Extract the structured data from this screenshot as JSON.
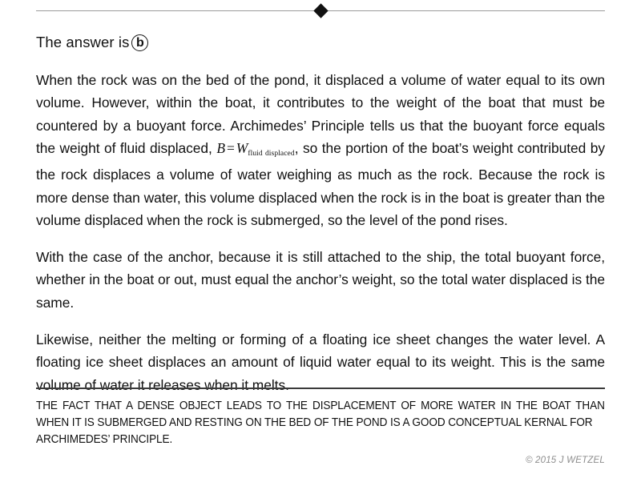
{
  "header": {
    "answer_prefix": "The answer is",
    "answer_choice": "b"
  },
  "body": {
    "paragraphs": [
      {
        "segments": [
          {
            "type": "text",
            "value": "When the rock was on the bed of the pond, it displaced a volume of water equal to its own volume.  However, within the boat, it contributes to the weight of the boat that must be countered by a buoyant force.  Archimedes’ Principle tells us that the buoyant force equals the weight of fluid displaced, "
          },
          {
            "type": "math",
            "lhs": "B",
            "operator": "=",
            "rhs": "W",
            "subscript": "fluid displaced"
          },
          {
            "type": "text",
            "value": ", so the portion of the boat’s weight contributed by the rock displaces a volume of water weighing as much as the rock.  Because the rock is more dense than water, this volume displaced when the rock is in the boat is greater than the volume displaced when the rock is submerged, so the level of the pond rises."
          }
        ]
      },
      {
        "segments": [
          {
            "type": "text",
            "value": "With the case of the anchor, because it is still attached to the ship, the total buoyant force, whether in the boat or out, must equal the anchor’s weight, so the total water displaced is the same."
          }
        ]
      },
      {
        "segments": [
          {
            "type": "text",
            "value": "Likewise, neither the melting or forming of a floating ice sheet changes the water level.  A floating ice sheet displaces an amount of liquid water equal to its weight.  This is the same volume of water it releases when it melts."
          }
        ]
      }
    ]
  },
  "footer": {
    "note_main": "THE FACT THAT A DENSE OBJECT LEADS TO THE DISPLACEMENT OF MORE WATER IN THE BOAT THAN WHEN IT IS SUBMERGED AND RESTING ON THE BED OF THE POND IS A GOOD CONCEPTUAL KERNAL FOR",
    "note_last_line": "ARCHIMEDES’ PRINCIPLE.",
    "copyright": "© 2015 J WETZEL"
  },
  "colors": {
    "text": "#111111",
    "top_rule": "#9a9a9a",
    "bottom_rule": "#3a3a3a",
    "copyright": "#8d8d8d"
  }
}
